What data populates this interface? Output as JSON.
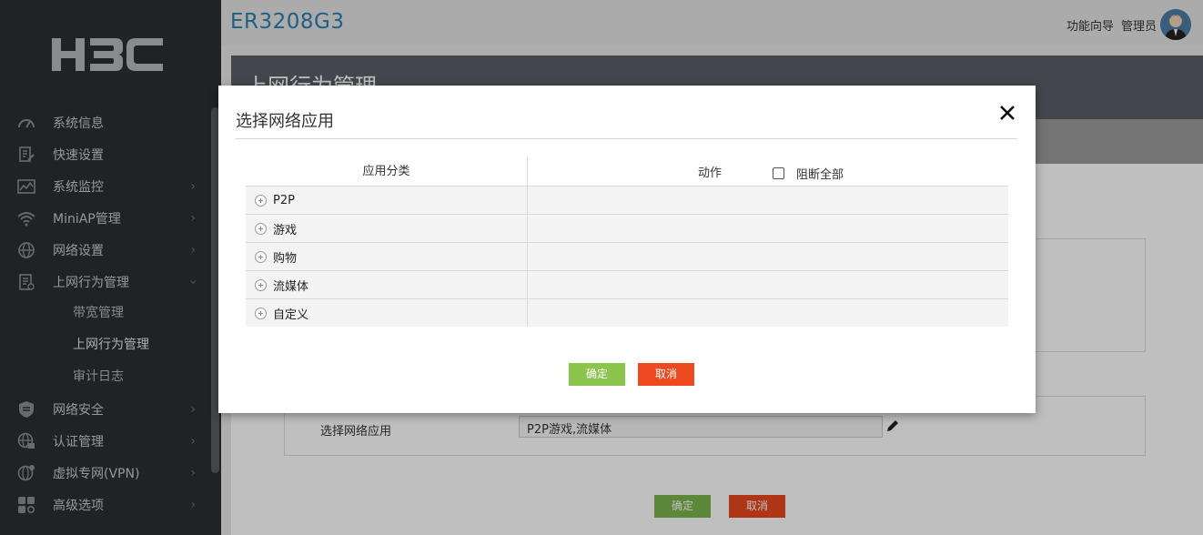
{
  "brand": {
    "logo_text": "H3C",
    "device_name": "ER3208G3"
  },
  "top_links": {
    "wizard": "功能向导",
    "admin": "管理员"
  },
  "sidebar": {
    "items": [
      {
        "label": "系统信息",
        "icon": "speedometer-icon",
        "has_arrow": false
      },
      {
        "label": "快速设置",
        "icon": "edit-document-icon",
        "has_arrow": false
      },
      {
        "label": "系统监控",
        "icon": "chart-monitor-icon",
        "has_arrow": true
      },
      {
        "label": "MiniAP管理",
        "icon": "wifi-icon",
        "has_arrow": true
      },
      {
        "label": "网络设置",
        "icon": "globe-icon",
        "has_arrow": true
      },
      {
        "label": "上网行为管理",
        "icon": "document-icon",
        "has_arrow": true,
        "expanded": true
      }
    ],
    "sub_items": [
      {
        "label": "带宽管理"
      },
      {
        "label": "上网行为管理",
        "active": true
      },
      {
        "label": "审计日志"
      }
    ],
    "items_after": [
      {
        "label": "网络安全",
        "icon": "shield-icon",
        "has_arrow": true
      },
      {
        "label": "认证管理",
        "icon": "globe-lock-icon",
        "has_arrow": true
      },
      {
        "label": "虚拟专网(VPN)",
        "icon": "vpn-icon",
        "has_arrow": true
      },
      {
        "label": "高级选项",
        "icon": "grid-icon",
        "has_arrow": true
      }
    ]
  },
  "background_page": {
    "header_title": "上网行为管理",
    "select_app_label": "选择网络应用",
    "select_app_value": "P2P游戏,流媒体",
    "ok_label": "确定",
    "cancel_label": "取消"
  },
  "modal": {
    "title": "选择网络应用",
    "col_category": "应用分类",
    "col_action": "动作",
    "block_all_label": "阻断全部",
    "block_all_checked": false,
    "categories": [
      "P2P",
      "游戏",
      "购物",
      "流媒体",
      "自定义"
    ],
    "ok_label": "确定",
    "cancel_label": "取消"
  },
  "colors": {
    "sidebar_bg": "#2b2e33",
    "device_name": "#2a7fb0",
    "ok_button": "#8bc54e",
    "cancel_button": "#ee4a21"
  }
}
